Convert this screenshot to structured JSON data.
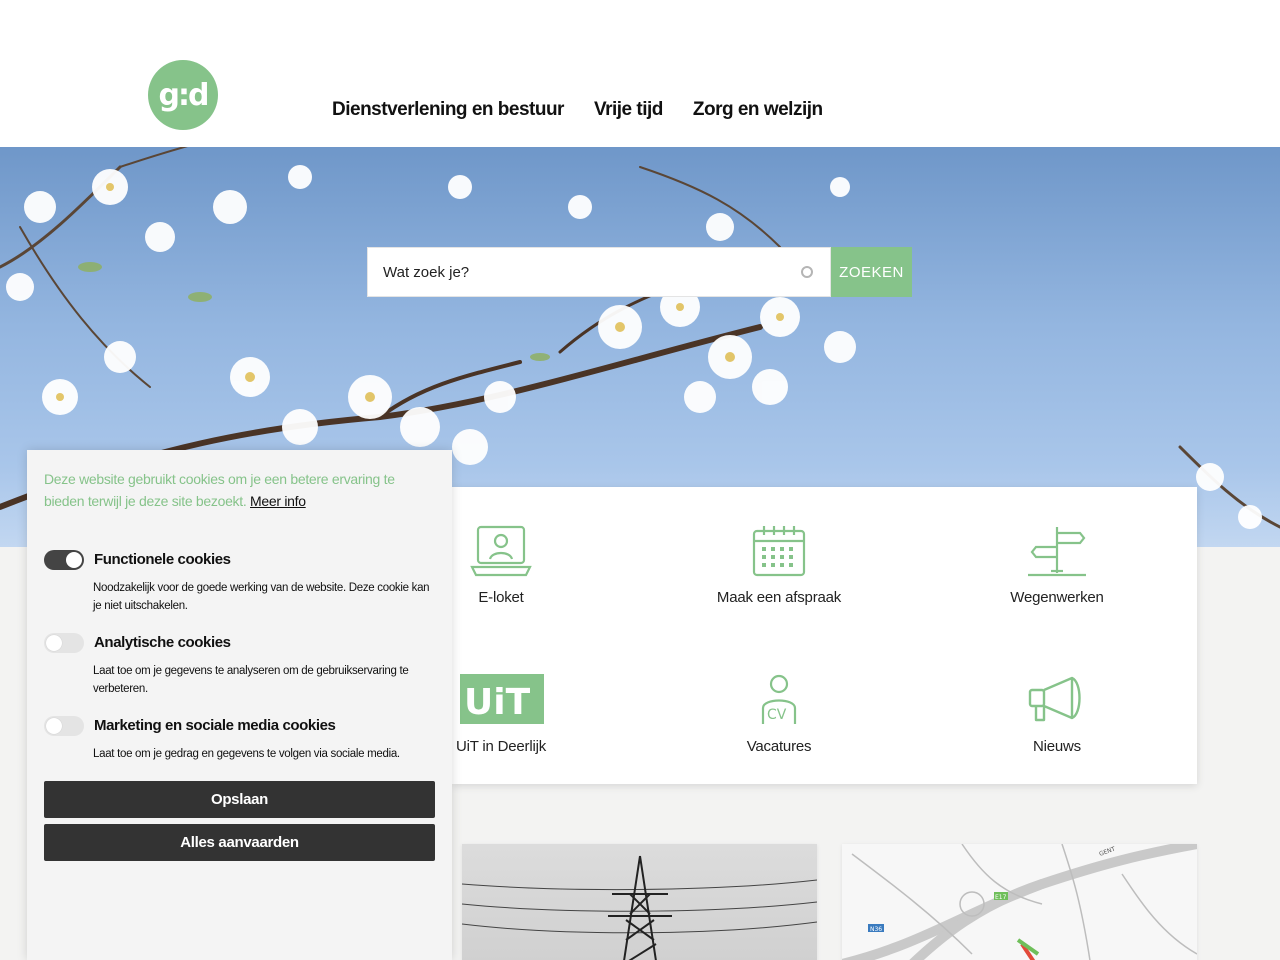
{
  "header": {
    "logo_text": "g:d",
    "nav": [
      "Dienstverlening en bestuur",
      "Vrije tijd",
      "Zorg en welzijn"
    ]
  },
  "search": {
    "placeholder": "Wat zoek je?",
    "button_label": "ZOEKEN"
  },
  "quick_links": [
    {
      "label": "E-loket",
      "icon": "computer-user-icon"
    },
    {
      "label": "Maak een afspraak",
      "icon": "calendar-icon"
    },
    {
      "label": "Wegenwerken",
      "icon": "signpost-icon"
    },
    {
      "label": "UiT in Deerlijk",
      "icon": "uit-logo",
      "logo_text": "UiT"
    },
    {
      "label": "Vacatures",
      "icon": "person-cv-icon",
      "icon_text": "CV"
    },
    {
      "label": "Nieuws",
      "icon": "megaphone-icon"
    }
  ],
  "cookie": {
    "intro": "Deze website gebruikt cookies om je een betere ervaring te bieden terwijl je deze site bezoekt.",
    "more_info": "Meer info",
    "options": [
      {
        "title": "Functionele cookies",
        "description": "Noodzakelijk voor de goede werking van de website. Deze cookie kan je niet uitschakelen.",
        "enabled": true
      },
      {
        "title": "Analytische cookies",
        "description": "Laat toe om je gegevens te analyseren om de gebruikservaring te verbeteren.",
        "enabled": false
      },
      {
        "title": "Marketing en sociale media cookies",
        "description": "Laat toe om je gedrag en gegevens te volgen via sociale media.",
        "enabled": false
      }
    ],
    "save_label": "Opslaan",
    "accept_all_label": "Alles aanvaarden"
  },
  "map_labels": {
    "road1": "N36",
    "road2": "E17",
    "place": "GENT"
  },
  "colors": {
    "brand_green": "#86c38a",
    "dark_button": "#333333"
  }
}
